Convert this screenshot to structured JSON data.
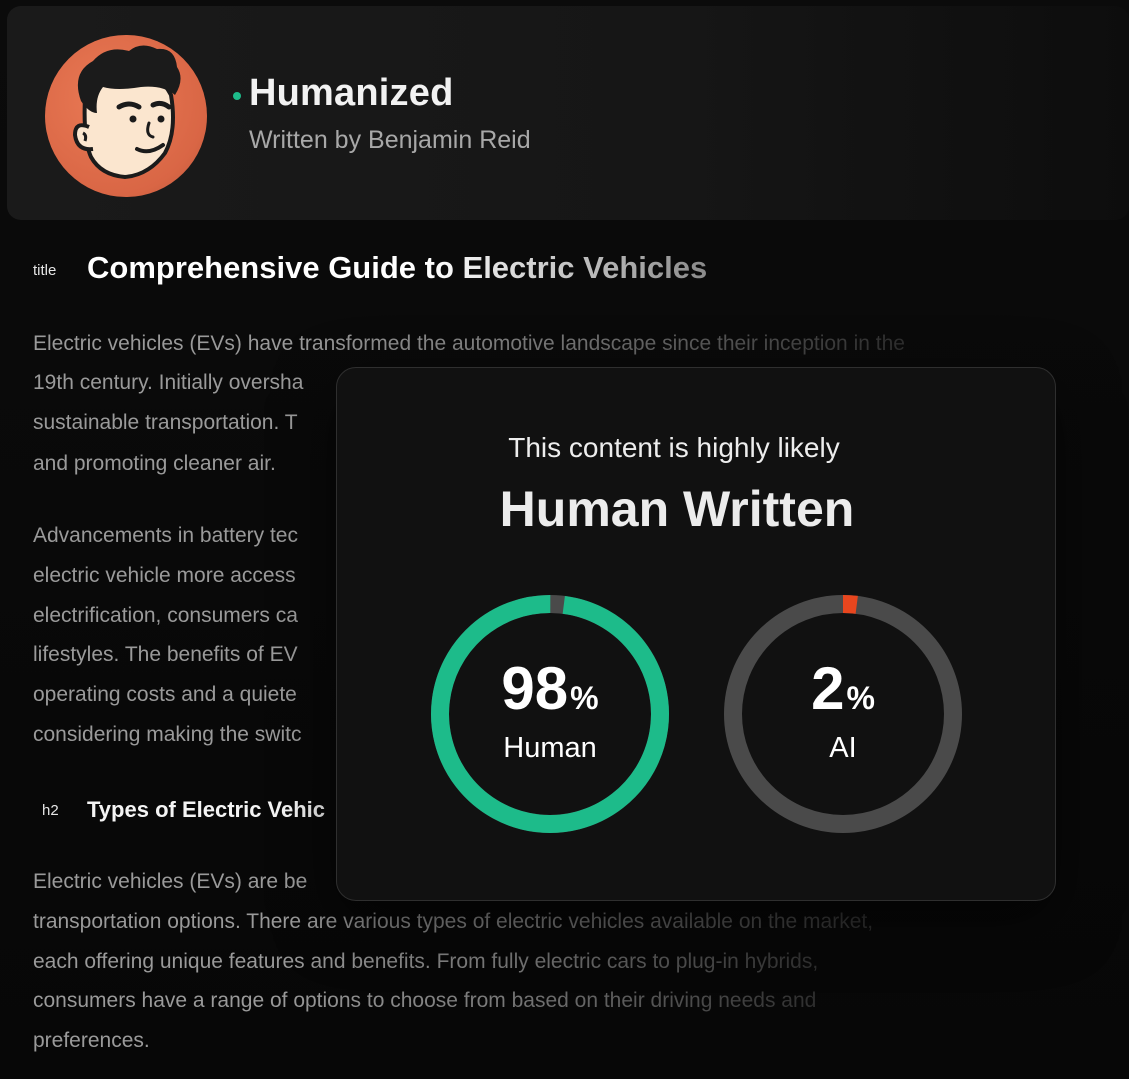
{
  "header": {
    "status_label": "Humanized",
    "author": "Written by Benjamin Reid",
    "status_color": "#1dbb8a"
  },
  "article": {
    "title_tag": "title",
    "title": "Comprehensive Guide to Electric Vehicles",
    "h2_tag": "h2",
    "h2_title": "Types of Electric Vehic",
    "lines": [
      "Electric vehicles (EVs) have transformed the automotive landscape since their inception in the",
      "19th century. Initially oversha",
      "sustainable transportation. T",
      "and promoting cleaner air.",
      "Advancements in battery tec",
      "electric vehicle more access",
      "electrification, consumers ca",
      "lifestyles. The benefits of EV",
      "operating costs and a quiete",
      "considering making the switc",
      "Electric vehicles (EVs) are be",
      "transportation options. There are various types of electric vehicles available on the market,",
      "each offering unique features and benefits. From fully electric cars to plug-in hybrids,",
      "consumers have a range of options to choose from based on their driving needs and",
      "preferences."
    ]
  },
  "result": {
    "likely_text": "This content is highly likely",
    "verdict": "Human Written",
    "human": {
      "value": "98",
      "unit": "%",
      "label": "Human",
      "fraction": 0.98,
      "color": "#1dbb8a"
    },
    "ai": {
      "value": "2",
      "unit": "%",
      "label": "AI",
      "fraction": 0.02,
      "color": "#e8461e"
    },
    "track_color": "#4a4a4a"
  }
}
